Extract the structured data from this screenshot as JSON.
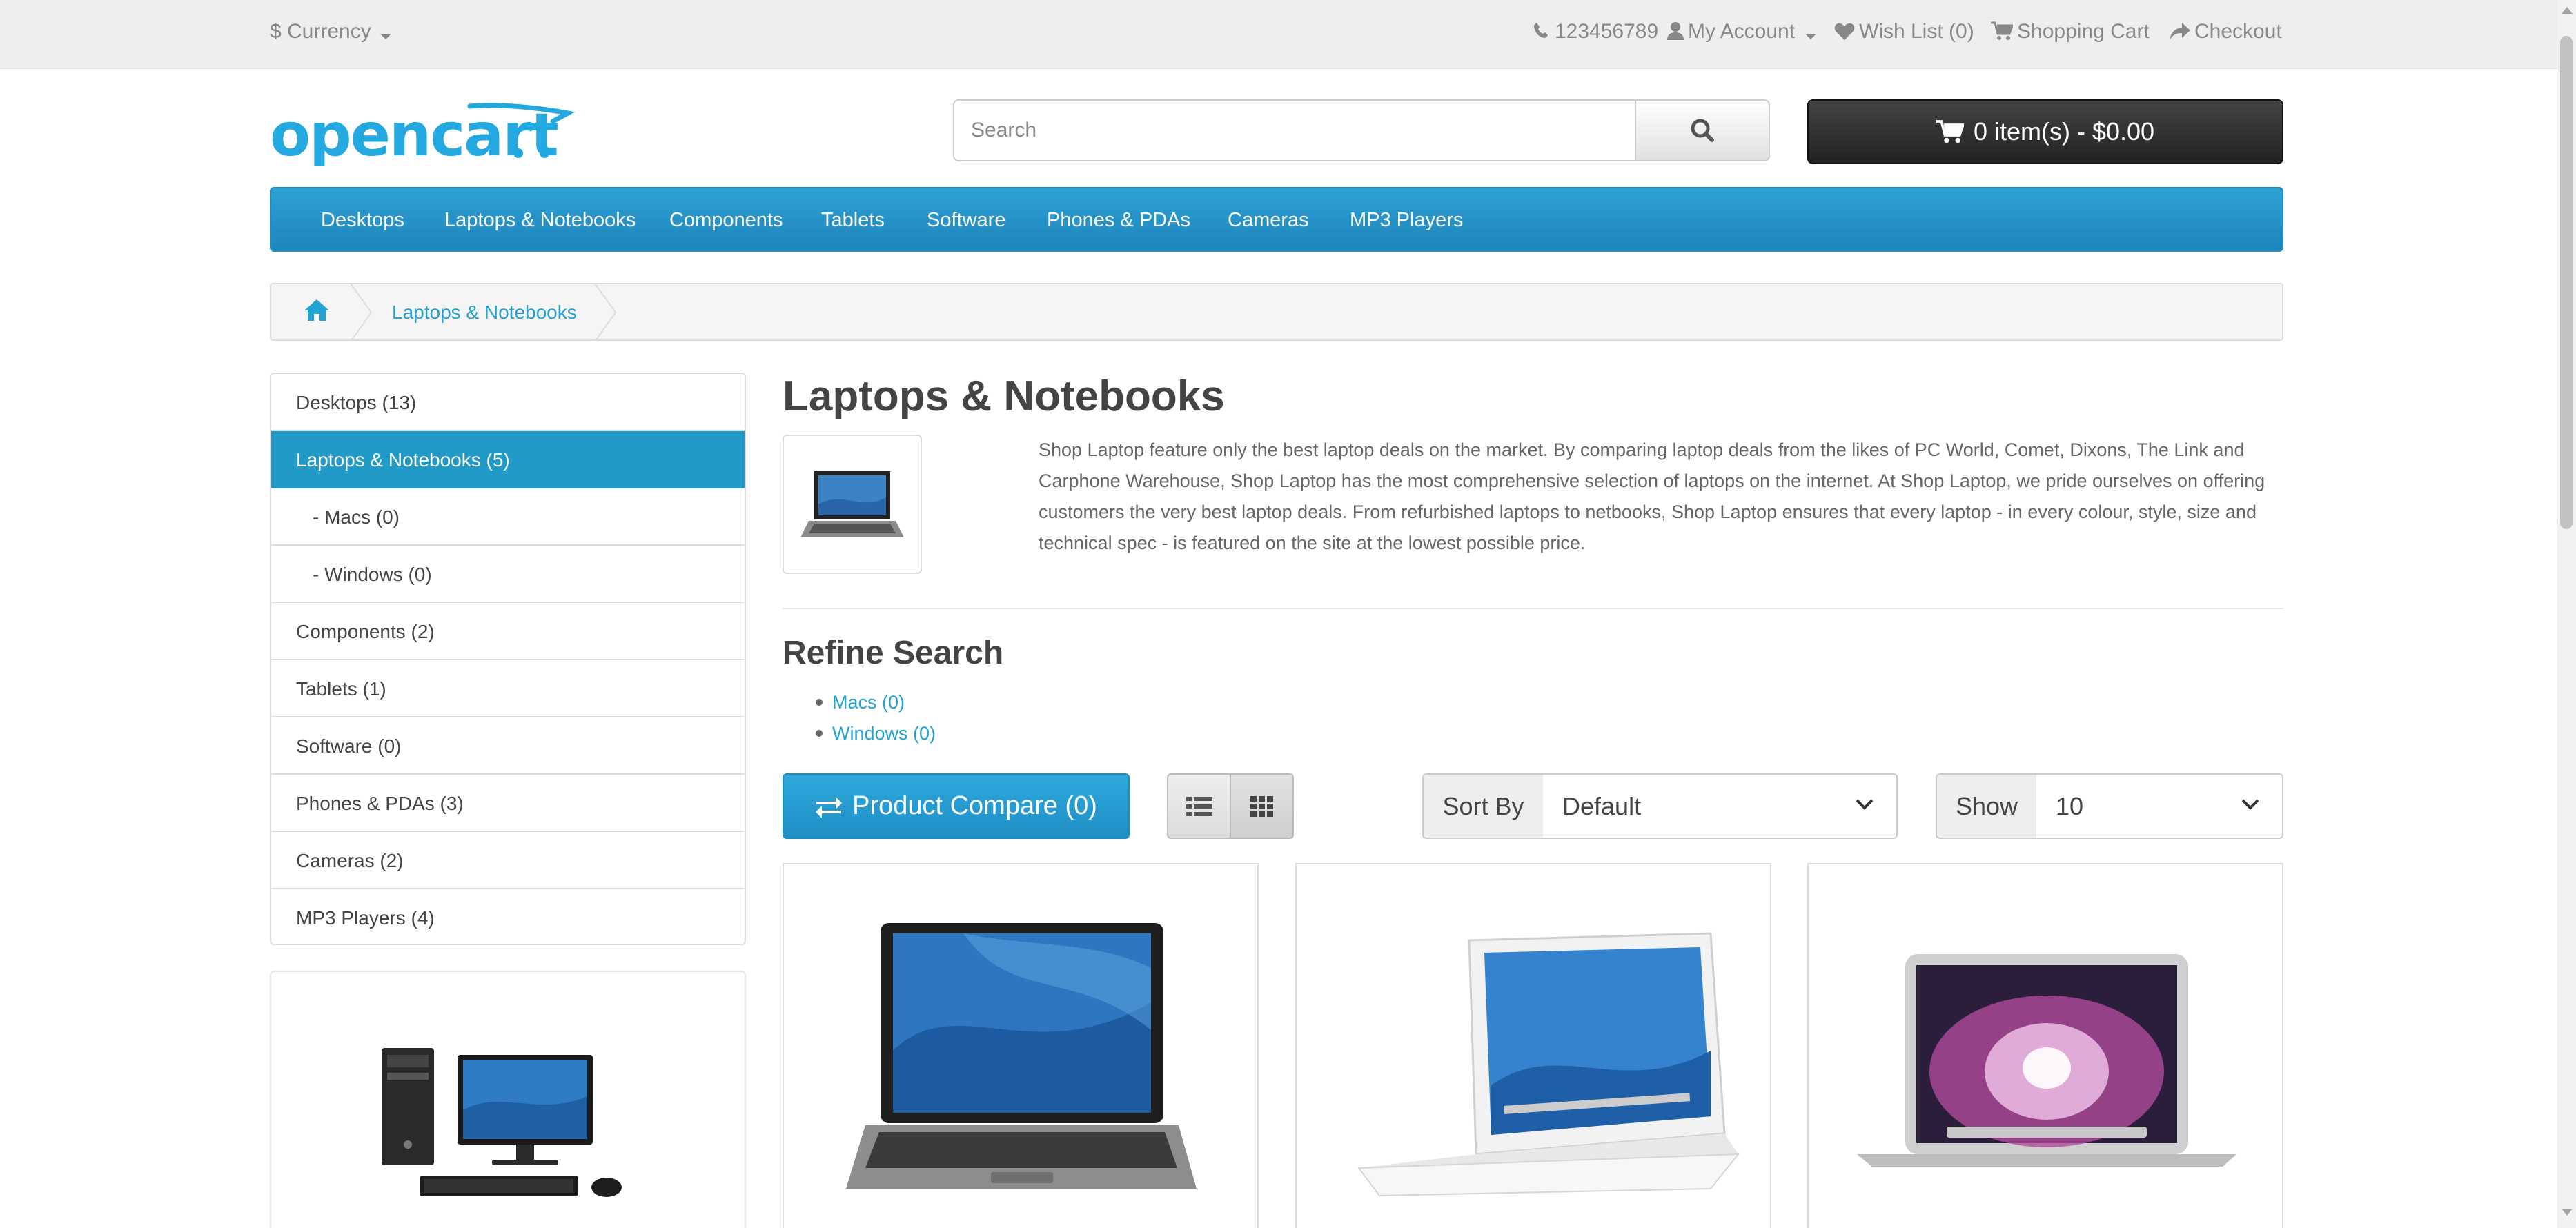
{
  "top_bar": {
    "currency": "$ Currency",
    "phone": "123456789",
    "my_account": "My Account",
    "wish_list": "Wish List (0)",
    "shopping_cart": "Shopping Cart",
    "checkout": "Checkout"
  },
  "header": {
    "logo_text": "opencart",
    "search_placeholder": "Search",
    "cart_label": "0 item(s) - $0.00"
  },
  "menu": [
    "Desktops",
    "Laptops & Notebooks",
    "Components",
    "Tablets",
    "Software",
    "Phones & PDAs",
    "Cameras",
    "MP3 Players"
  ],
  "breadcrumb": {
    "current": "Laptops & Notebooks"
  },
  "sidebar": {
    "items": [
      {
        "label": "Desktops (13)",
        "active": false
      },
      {
        "label": "Laptops & Notebooks (5)",
        "active": true
      },
      {
        "label": "- Macs (0)",
        "active": false
      },
      {
        "label": "- Windows (0)",
        "active": false
      },
      {
        "label": "Components (2)",
        "active": false
      },
      {
        "label": "Tablets (1)",
        "active": false
      },
      {
        "label": "Software (0)",
        "active": false
      },
      {
        "label": "Phones & PDAs (3)",
        "active": false
      },
      {
        "label": "Cameras (2)",
        "active": false
      },
      {
        "label": "MP3 Players (4)",
        "active": false
      }
    ]
  },
  "content": {
    "title": "Laptops & Notebooks",
    "description": "Shop Laptop feature only the best laptop deals on the market. By comparing laptop deals from the likes of PC World, Comet, Dixons, The Link and Carphone Warehouse, Shop Laptop has the most comprehensive selection of laptops on the internet. At Shop Laptop, we pride ourselves on offering customers the very best laptop deals. From refurbished laptops to netbooks, Shop Laptop ensures that every laptop - in every colour, style, size and technical spec - is featured on the site at the lowest possible price.",
    "refine_title": "Refine Search",
    "refine_links": [
      "Macs (0)",
      "Windows (0)"
    ],
    "compare_label": "Product Compare (0)",
    "sort_label": "Sort By",
    "sort_value": "Default",
    "show_label": "Show",
    "show_value": "10"
  },
  "colors": {
    "accent": "#229ac8",
    "link": "#23a1d1",
    "cart_button": "#303030"
  }
}
